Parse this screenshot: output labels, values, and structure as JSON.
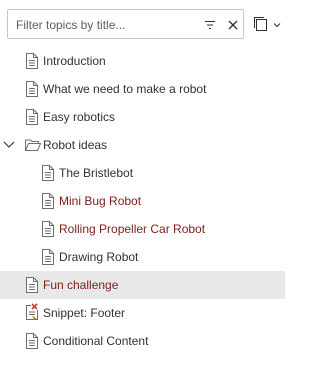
{
  "filter": {
    "placeholder": "Filter topics by title...",
    "value": ""
  },
  "icons": {
    "sort": "filter-lines-icon",
    "clear": "close-icon",
    "view": "copy-view-icon",
    "topic": "document-icon",
    "folder": "open-folder-icon",
    "snippet": "snippet-error-icon",
    "chevron": "chevron-down-icon"
  },
  "colors": {
    "modified": "#7a1f1a",
    "selected_bg": "#e8e8e8",
    "border": "#c8c6c4"
  },
  "tree": {
    "items": [
      {
        "label": "Introduction",
        "type": "topic",
        "level": 1
      },
      {
        "label": "What we need to make a robot",
        "type": "topic",
        "level": 1
      },
      {
        "label": "Easy robotics",
        "type": "topic",
        "level": 1
      },
      {
        "label": "Robot ideas",
        "type": "folder",
        "level": 1,
        "expanded": true
      },
      {
        "label": "The Bristlebot",
        "type": "topic",
        "level": 2
      },
      {
        "label": "Mini Bug Robot",
        "type": "topic",
        "level": 2,
        "modified": true
      },
      {
        "label": "Rolling Propeller Car Robot",
        "type": "topic",
        "level": 2,
        "modified": true
      },
      {
        "label": "Drawing Robot",
        "type": "topic",
        "level": 2
      },
      {
        "label": "Fun challenge",
        "type": "topic",
        "level": 1,
        "modified": true,
        "selected": true
      },
      {
        "label": "Snippet: Footer",
        "type": "snippet",
        "level": 1
      },
      {
        "label": "Conditional Content",
        "type": "topic",
        "level": 1
      }
    ]
  }
}
